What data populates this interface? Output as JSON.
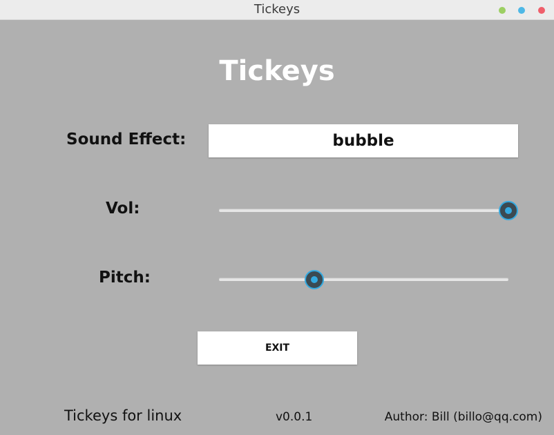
{
  "window": {
    "title": "Tickeys",
    "controls": [
      {
        "name": "minimize",
        "color": "#9ccf63"
      },
      {
        "name": "maximize",
        "color": "#4eb8e6"
      },
      {
        "name": "close",
        "color": "#ef5f6b"
      }
    ]
  },
  "app": {
    "title": "Tickeys"
  },
  "sound_effect": {
    "label": "Sound Effect:",
    "selected": "bubble"
  },
  "volume": {
    "label": "Vol:",
    "value_fraction": 1.0
  },
  "pitch": {
    "label": "Pitch:",
    "value_fraction": 0.33
  },
  "exit_button": {
    "label": "EXIT"
  },
  "footer": {
    "app_name": "Tickeys for linux",
    "version": "v0.0.1",
    "author": "Author: Bill (billo@qq.com)"
  },
  "colors": {
    "background": "#b0b0b0",
    "accent": "#33a9e0",
    "thumb": "#3b4a52"
  }
}
